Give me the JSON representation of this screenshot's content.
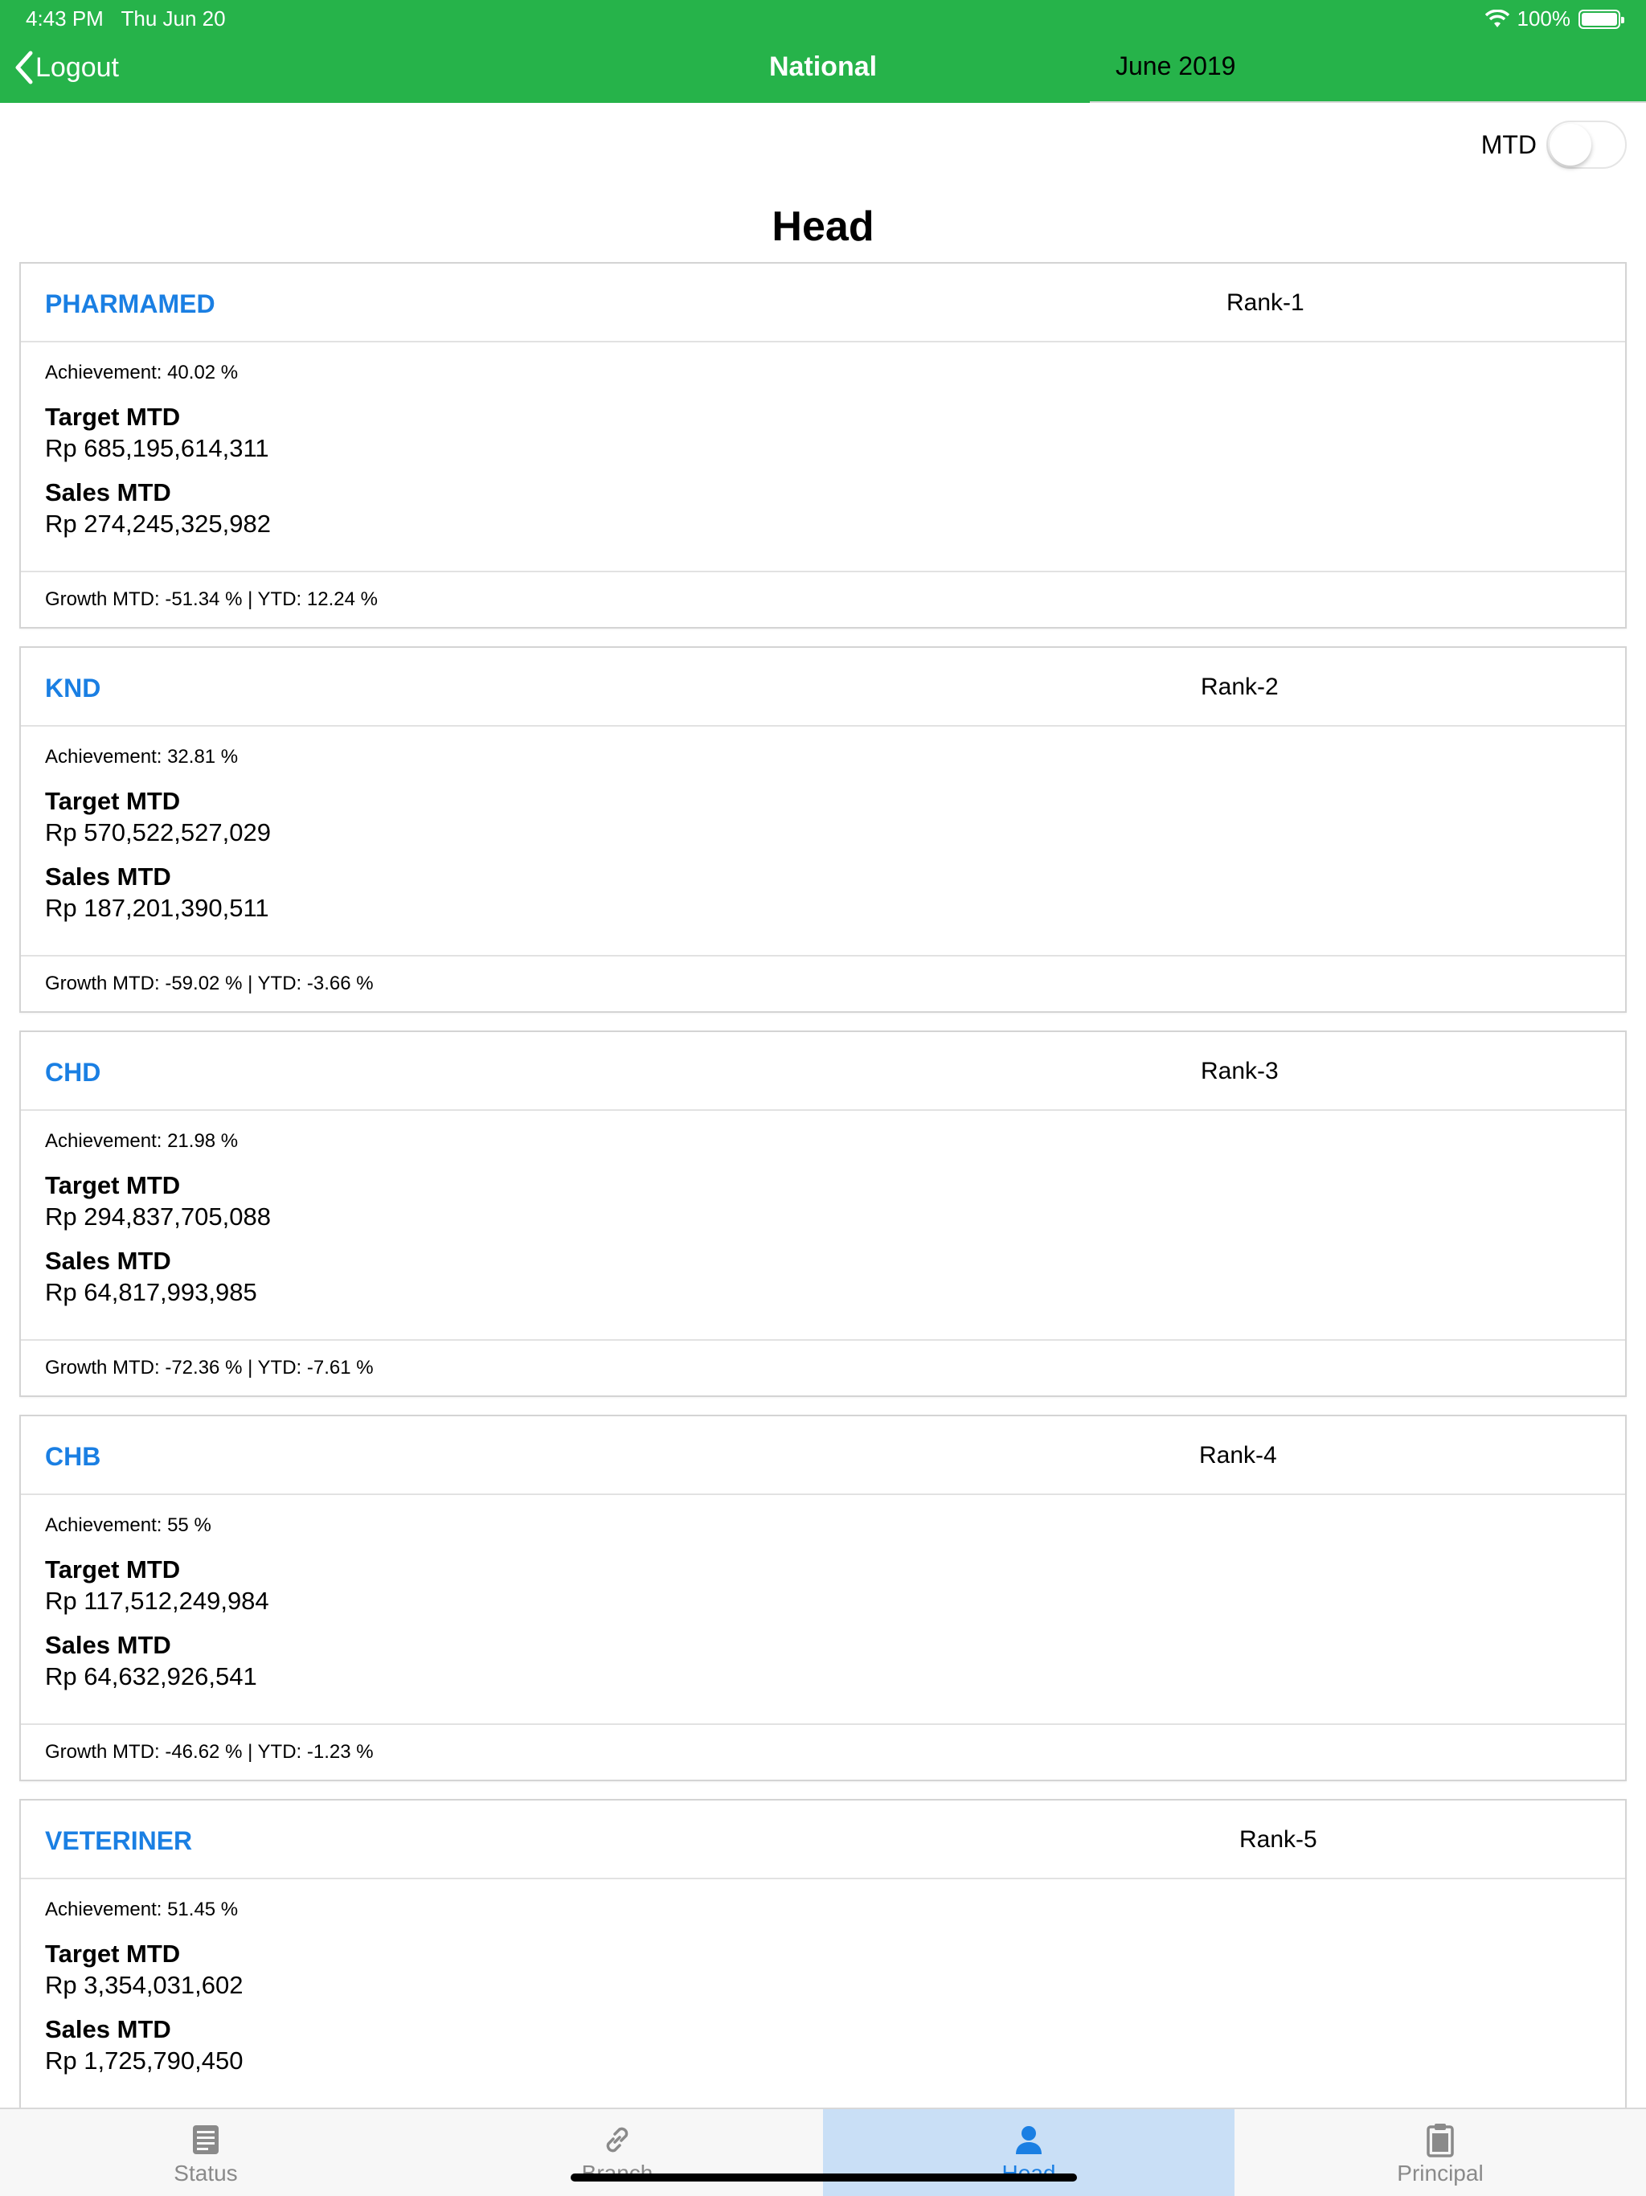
{
  "status_bar": {
    "time": "4:43 PM",
    "date": "Thu Jun 20",
    "battery": "100%"
  },
  "nav": {
    "back_label": "Logout",
    "title": "National",
    "month": "June 2019"
  },
  "toggle": {
    "label": "MTD",
    "on": false
  },
  "page_title": "Head",
  "cards": [
    {
      "name": "PHARMAMED",
      "rank": "Rank-1",
      "achievement": "Achievement: 40.02 %",
      "target_label": "Target MTD",
      "target_value": "Rp 685,195,614,311",
      "sales_label": "Sales MTD",
      "sales_value": "Rp 274,245,325,982",
      "growth": "Growth MTD: -51.34 % | YTD: 12.24 %"
    },
    {
      "name": "KND",
      "rank": "Rank-2",
      "achievement": "Achievement: 32.81 %",
      "target_label": "Target MTD",
      "target_value": "Rp 570,522,527,029",
      "sales_label": "Sales MTD",
      "sales_value": "Rp 187,201,390,511",
      "growth": "Growth MTD: -59.02 % | YTD: -3.66 %"
    },
    {
      "name": "CHD",
      "rank": "Rank-3",
      "achievement": "Achievement: 21.98 %",
      "target_label": "Target MTD",
      "target_value": "Rp 294,837,705,088",
      "sales_label": "Sales MTD",
      "sales_value": "Rp 64,817,993,985",
      "growth": "Growth MTD: -72.36 % | YTD: -7.61 %"
    },
    {
      "name": "CHB",
      "rank": "Rank-4",
      "achievement": "Achievement: 55 %",
      "target_label": "Target MTD",
      "target_value": "Rp 117,512,249,984",
      "sales_label": "Sales MTD",
      "sales_value": "Rp 64,632,926,541",
      "growth": "Growth MTD: -46.62 % | YTD: -1.23 %"
    },
    {
      "name": "VETERINER",
      "rank": "Rank-5",
      "achievement": "Achievement: 51.45 %",
      "target_label": "Target MTD",
      "target_value": "Rp 3,354,031,602",
      "sales_label": "Sales MTD",
      "sales_value": "Rp 1,725,790,450",
      "growth": ""
    }
  ],
  "tabs": [
    {
      "label": "Status",
      "icon": "document-icon",
      "active": false
    },
    {
      "label": "Branch",
      "icon": "link-icon",
      "active": false
    },
    {
      "label": "Head",
      "icon": "person-icon",
      "active": true
    },
    {
      "label": "Principal",
      "icon": "clipboard-icon",
      "active": false
    }
  ],
  "colors": {
    "header": "#26b34a",
    "accent": "#1a7fe3",
    "active_tab": "#c9dff6"
  }
}
